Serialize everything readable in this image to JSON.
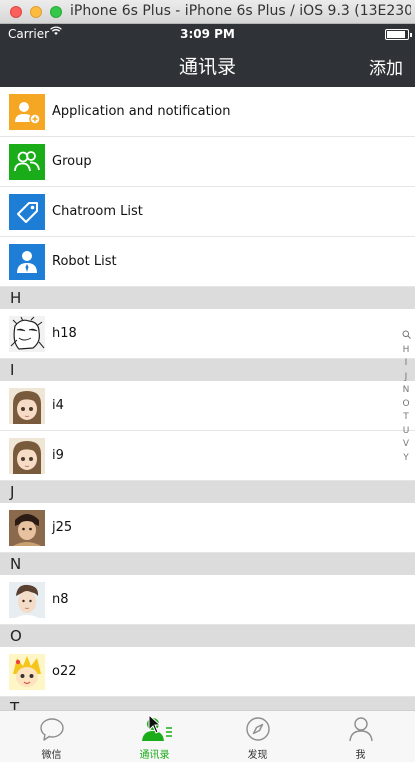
{
  "window": {
    "title": "iPhone 6s Plus - iPhone 6s Plus / iOS 9.3 (13E230)"
  },
  "status_bar": {
    "carrier": "Carrier",
    "time": "3:09 PM",
    "battery_level": 0.9
  },
  "nav": {
    "title": "通讯录",
    "add_label": "添加"
  },
  "colors": {
    "nav_bg": "#2f3236",
    "orange": "#f5a623",
    "green": "#1aad19",
    "blue": "#1e7ed6",
    "section_bg": "#dcdcdc"
  },
  "menu": [
    {
      "label": "Application and notification",
      "icon": "add-user-icon"
    },
    {
      "label": "Group",
      "icon": "group-icon"
    },
    {
      "label": "Chatroom List",
      "icon": "tag-icon"
    },
    {
      "label": "Robot List",
      "icon": "robot-icon"
    }
  ],
  "sections": [
    {
      "letter": "H",
      "contacts": [
        "h18"
      ]
    },
    {
      "letter": "I",
      "contacts": [
        "i4",
        "i9"
      ]
    },
    {
      "letter": "J",
      "contacts": [
        "j25"
      ]
    },
    {
      "letter": "N",
      "contacts": [
        "n8"
      ]
    },
    {
      "letter": "O",
      "contacts": [
        "o22"
      ]
    },
    {
      "letter": "T",
      "contacts": []
    }
  ],
  "index": [
    "Q",
    "H",
    "I",
    "J",
    "N",
    "O",
    "T",
    "U",
    "V",
    "Y"
  ],
  "tabs": [
    {
      "label": "微信",
      "icon": "chat-bubble-icon"
    },
    {
      "label": "通讯录",
      "icon": "contacts-icon"
    },
    {
      "label": "发现",
      "icon": "compass-icon"
    },
    {
      "label": "我",
      "icon": "person-icon"
    }
  ]
}
